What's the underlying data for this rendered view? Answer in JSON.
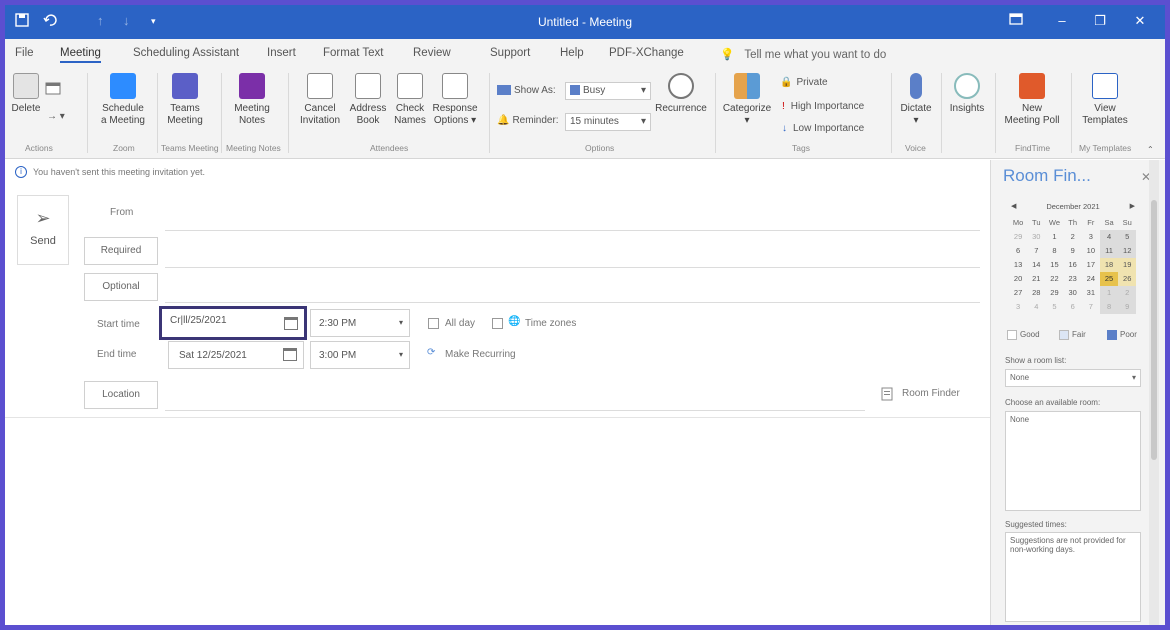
{
  "window": {
    "title": "Untitled  -  Meeting",
    "save_icon": "save-icon",
    "undo_icon": "undo-icon",
    "restore_ribbon_icon": "ribbon-display-icon",
    "minimize": "–",
    "maximize": "❐",
    "close": "✕"
  },
  "tabs": [
    "File",
    "Meeting",
    "Scheduling Assistant",
    "Insert",
    "Format Text",
    "Review",
    "Support",
    "Help",
    "PDF-XChange"
  ],
  "active_tab": "Meeting",
  "tell_me": "Tell me what you want to do",
  "ribbon": {
    "delete": "Delete",
    "schedule_meeting": [
      "Schedule",
      "a Meeting"
    ],
    "teams_meeting": [
      "Teams",
      "Meeting"
    ],
    "meeting_notes": [
      "Meeting",
      "Notes"
    ],
    "cancel_invitation": [
      "Cancel",
      "Invitation"
    ],
    "address_book": [
      "Address",
      "Book"
    ],
    "check_names": [
      "Check",
      "Names"
    ],
    "response_options": [
      "Response",
      "Options ▾"
    ],
    "show_as_label": "Show As:",
    "show_as_value": "Busy",
    "reminder_label": "Reminder:",
    "reminder_value": "15 minutes",
    "recurrence": "Recurrence",
    "categorize": "Categorize",
    "private": "Private",
    "high_importance": "High Importance",
    "low_importance": "Low Importance",
    "dictate": "Dictate",
    "insights": "Insights",
    "new_meeting_poll": [
      "New",
      "Meeting Poll"
    ],
    "view_templates": [
      "View",
      "Templates"
    ],
    "groups": {
      "actions": "Actions",
      "zoom": "Zoom",
      "teams_meeting": "Teams Meeting",
      "meeting_notes": "Meeting Notes",
      "attendees": "Attendees",
      "options": "Options",
      "tags": "Tags",
      "voice": "Voice",
      "findtime": "FindTime",
      "my_templates": "My Templates"
    }
  },
  "info_bar": "You haven't sent this meeting invitation yet.",
  "form": {
    "send": "Send",
    "from_label": "From",
    "required": "Required",
    "optional": "Optional",
    "start_time_label": "Start time",
    "start_date": "Cr|ll/25/2021",
    "start_time": "2:30 PM",
    "all_day": "All day",
    "time_zones": "Time zones",
    "end_time_label": "End time",
    "end_date": "Sat 12/25/2021",
    "end_time": "3:00 PM",
    "make_recurring": "Make Recurring",
    "location": "Location",
    "room_finder": "Room Finder"
  },
  "room_finder": {
    "title": "Room Fin...",
    "close": "✕",
    "month": "December 2021",
    "days_of_week": [
      "Mo",
      "Tu",
      "We",
      "Th",
      "Fr",
      "Sa",
      "Su"
    ],
    "weeks": [
      [
        "29",
        "30",
        "1",
        "2",
        "3",
        "4",
        "5"
      ],
      [
        "6",
        "7",
        "8",
        "9",
        "10",
        "11",
        "12"
      ],
      [
        "13",
        "14",
        "15",
        "16",
        "17",
        "18",
        "19"
      ],
      [
        "20",
        "21",
        "22",
        "23",
        "24",
        "25",
        "26"
      ],
      [
        "27",
        "28",
        "29",
        "30",
        "31",
        "1",
        "2"
      ],
      [
        "3",
        "4",
        "5",
        "6",
        "7",
        "8",
        "9"
      ]
    ],
    "selected_day": "25",
    "legend": [
      "Good",
      "Fair",
      "Poor"
    ],
    "legend_colors": [
      "#ffffff",
      "#dce6f5",
      "#5b7fc8"
    ],
    "room_list_label": "Show a room list:",
    "room_list_value": "None",
    "choose_room_label": "Choose an available room:",
    "choose_room_value": "None",
    "suggested_label": "Suggested times:",
    "suggested_text": "Suggestions are not provided for non-working days."
  },
  "colors": {
    "title_bar": "#2b63c5",
    "frame": "#5b4fd0",
    "accent_text": "#5a8ed6"
  }
}
